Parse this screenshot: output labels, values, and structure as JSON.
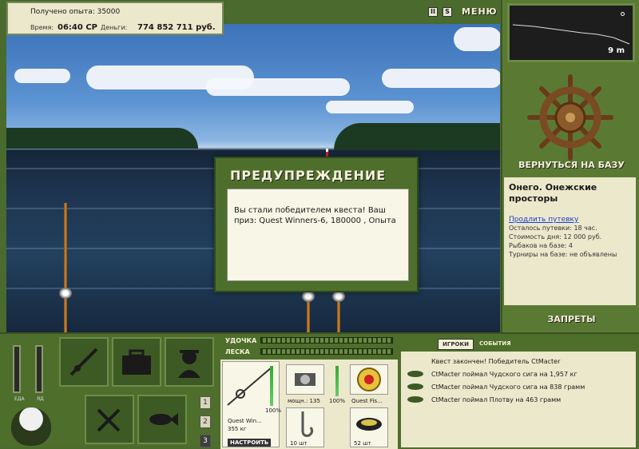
{
  "info": {
    "experience": "Получено опыта: 35000",
    "time_label": "Время:",
    "time_value": "06:40 СР",
    "money_label": "Деньги:",
    "money_value": "774 852 711 руб."
  },
  "controls": {
    "pause": "II",
    "sound": "S",
    "menu": "МЕНЮ"
  },
  "depth": {
    "value": "9 m"
  },
  "base": {
    "return_button": "ВЕРНУТЬСЯ НА БАЗУ",
    "location": "Онего. Онежские просторы",
    "extend_link": "Продлить путевку",
    "lines": [
      "Осталось путевки: 18 час.",
      "Стоимость дня: 12 000 руб.",
      "Рыбаков на базе: 4",
      "Турниры на базе: не объявлены"
    ],
    "bans_button": "ЗАПРЕТЫ"
  },
  "dialog": {
    "title": "ПРЕДУПРЕЖДЕНИЕ",
    "message": "Вы стали победителем квеста! Ваш приз: Quest Winners-6, 180000 , Опыта"
  },
  "needs": {
    "food_label": "ЕДА",
    "poison_label": "ЯД"
  },
  "pages": [
    "1",
    "2",
    "3"
  ],
  "tackle": {
    "rod_label": "УДОЧКА",
    "line_label": "ЛЕСКА",
    "rod_name": "Quest Win...",
    "rod_weight": "355 кг",
    "rod_percent": "100%",
    "reel_stat": "мощн.: 135",
    "reel_percent": "100%",
    "line_name": "Quest Fis...",
    "setup_button": "НАСТРОИТЬ",
    "hook_count": "10 шт",
    "bait_count": "52 шт"
  },
  "events": {
    "tab_players": "ИГРОКИ",
    "tab_events": "СОБЫТИЯ",
    "items": [
      "Квест закончен! Победитель CtMacter",
      "CtMacter поймал Чудского сига на 1,957 кг",
      "CtMacter поймал Чудского сига на 838 грамм",
      "CtMacter поймал Плотву на 463 грамм"
    ]
  }
}
